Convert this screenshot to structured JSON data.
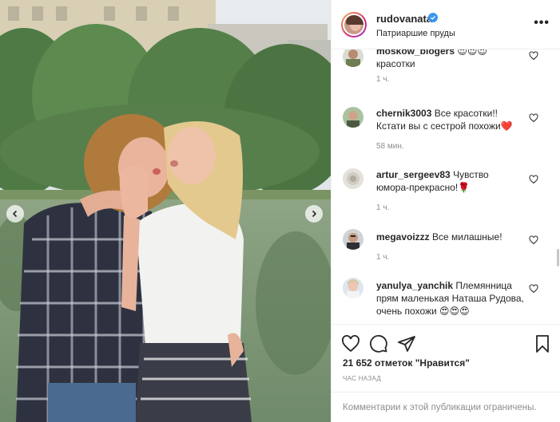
{
  "post": {
    "username": "rudovanata",
    "location": "Патриаршие пруды",
    "more_label": "•••",
    "verified": true,
    "likes_text": "21 652 отметок \"Нравится\"",
    "time_ago": "ЧАС НАЗАД",
    "comments_restricted": "Комментарии к этой публикации ограничены."
  },
  "comments": [
    {
      "username": "moskow_blogers",
      "text": "😍😍😍 красотки",
      "time": "1 ч."
    },
    {
      "username": "chernik3003",
      "text": "Все красотки!! Кстати вы с сестрой похожи❤️",
      "time": "58 мин."
    },
    {
      "username": "artur_sergeev83",
      "text": "Чувство юмора-прекрасно!🌹",
      "time": "1 ч."
    },
    {
      "username": "megavoizzz",
      "text": "Все милашные!",
      "time": "1 ч."
    },
    {
      "username": "yanulya_yanchik",
      "text": "Племянница прям маленькая Наташа Рудова, очень похожи 😍😍😍",
      "time": ""
    }
  ],
  "colors": {
    "accent": "#3897f0",
    "heart_red": "#ed4956",
    "muted": "#8e8e8e",
    "text": "#262626"
  },
  "icons": [
    "chevron-left-icon",
    "chevron-right-icon",
    "verified-icon",
    "heart-icon",
    "comment-icon",
    "share-icon",
    "bookmark-icon"
  ]
}
